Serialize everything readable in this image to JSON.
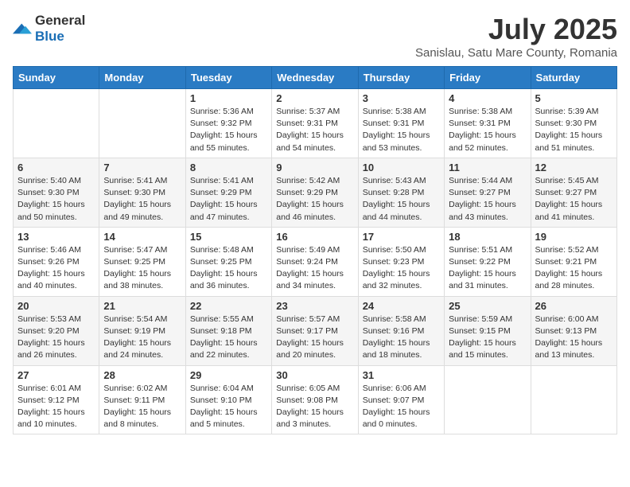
{
  "logo": {
    "general": "General",
    "blue": "Blue"
  },
  "title": "July 2025",
  "subtitle": "Sanislau, Satu Mare County, Romania",
  "days_of_week": [
    "Sunday",
    "Monday",
    "Tuesday",
    "Wednesday",
    "Thursday",
    "Friday",
    "Saturday"
  ],
  "weeks": [
    [
      {
        "day": "",
        "info": ""
      },
      {
        "day": "",
        "info": ""
      },
      {
        "day": "1",
        "info": "Sunrise: 5:36 AM\nSunset: 9:32 PM\nDaylight: 15 hours and 55 minutes."
      },
      {
        "day": "2",
        "info": "Sunrise: 5:37 AM\nSunset: 9:31 PM\nDaylight: 15 hours and 54 minutes."
      },
      {
        "day": "3",
        "info": "Sunrise: 5:38 AM\nSunset: 9:31 PM\nDaylight: 15 hours and 53 minutes."
      },
      {
        "day": "4",
        "info": "Sunrise: 5:38 AM\nSunset: 9:31 PM\nDaylight: 15 hours and 52 minutes."
      },
      {
        "day": "5",
        "info": "Sunrise: 5:39 AM\nSunset: 9:30 PM\nDaylight: 15 hours and 51 minutes."
      }
    ],
    [
      {
        "day": "6",
        "info": "Sunrise: 5:40 AM\nSunset: 9:30 PM\nDaylight: 15 hours and 50 minutes."
      },
      {
        "day": "7",
        "info": "Sunrise: 5:41 AM\nSunset: 9:30 PM\nDaylight: 15 hours and 49 minutes."
      },
      {
        "day": "8",
        "info": "Sunrise: 5:41 AM\nSunset: 9:29 PM\nDaylight: 15 hours and 47 minutes."
      },
      {
        "day": "9",
        "info": "Sunrise: 5:42 AM\nSunset: 9:29 PM\nDaylight: 15 hours and 46 minutes."
      },
      {
        "day": "10",
        "info": "Sunrise: 5:43 AM\nSunset: 9:28 PM\nDaylight: 15 hours and 44 minutes."
      },
      {
        "day": "11",
        "info": "Sunrise: 5:44 AM\nSunset: 9:27 PM\nDaylight: 15 hours and 43 minutes."
      },
      {
        "day": "12",
        "info": "Sunrise: 5:45 AM\nSunset: 9:27 PM\nDaylight: 15 hours and 41 minutes."
      }
    ],
    [
      {
        "day": "13",
        "info": "Sunrise: 5:46 AM\nSunset: 9:26 PM\nDaylight: 15 hours and 40 minutes."
      },
      {
        "day": "14",
        "info": "Sunrise: 5:47 AM\nSunset: 9:25 PM\nDaylight: 15 hours and 38 minutes."
      },
      {
        "day": "15",
        "info": "Sunrise: 5:48 AM\nSunset: 9:25 PM\nDaylight: 15 hours and 36 minutes."
      },
      {
        "day": "16",
        "info": "Sunrise: 5:49 AM\nSunset: 9:24 PM\nDaylight: 15 hours and 34 minutes."
      },
      {
        "day": "17",
        "info": "Sunrise: 5:50 AM\nSunset: 9:23 PM\nDaylight: 15 hours and 32 minutes."
      },
      {
        "day": "18",
        "info": "Sunrise: 5:51 AM\nSunset: 9:22 PM\nDaylight: 15 hours and 31 minutes."
      },
      {
        "day": "19",
        "info": "Sunrise: 5:52 AM\nSunset: 9:21 PM\nDaylight: 15 hours and 28 minutes."
      }
    ],
    [
      {
        "day": "20",
        "info": "Sunrise: 5:53 AM\nSunset: 9:20 PM\nDaylight: 15 hours and 26 minutes."
      },
      {
        "day": "21",
        "info": "Sunrise: 5:54 AM\nSunset: 9:19 PM\nDaylight: 15 hours and 24 minutes."
      },
      {
        "day": "22",
        "info": "Sunrise: 5:55 AM\nSunset: 9:18 PM\nDaylight: 15 hours and 22 minutes."
      },
      {
        "day": "23",
        "info": "Sunrise: 5:57 AM\nSunset: 9:17 PM\nDaylight: 15 hours and 20 minutes."
      },
      {
        "day": "24",
        "info": "Sunrise: 5:58 AM\nSunset: 9:16 PM\nDaylight: 15 hours and 18 minutes."
      },
      {
        "day": "25",
        "info": "Sunrise: 5:59 AM\nSunset: 9:15 PM\nDaylight: 15 hours and 15 minutes."
      },
      {
        "day": "26",
        "info": "Sunrise: 6:00 AM\nSunset: 9:13 PM\nDaylight: 15 hours and 13 minutes."
      }
    ],
    [
      {
        "day": "27",
        "info": "Sunrise: 6:01 AM\nSunset: 9:12 PM\nDaylight: 15 hours and 10 minutes."
      },
      {
        "day": "28",
        "info": "Sunrise: 6:02 AM\nSunset: 9:11 PM\nDaylight: 15 hours and 8 minutes."
      },
      {
        "day": "29",
        "info": "Sunrise: 6:04 AM\nSunset: 9:10 PM\nDaylight: 15 hours and 5 minutes."
      },
      {
        "day": "30",
        "info": "Sunrise: 6:05 AM\nSunset: 9:08 PM\nDaylight: 15 hours and 3 minutes."
      },
      {
        "day": "31",
        "info": "Sunrise: 6:06 AM\nSunset: 9:07 PM\nDaylight: 15 hours and 0 minutes."
      },
      {
        "day": "",
        "info": ""
      },
      {
        "day": "",
        "info": ""
      }
    ]
  ]
}
